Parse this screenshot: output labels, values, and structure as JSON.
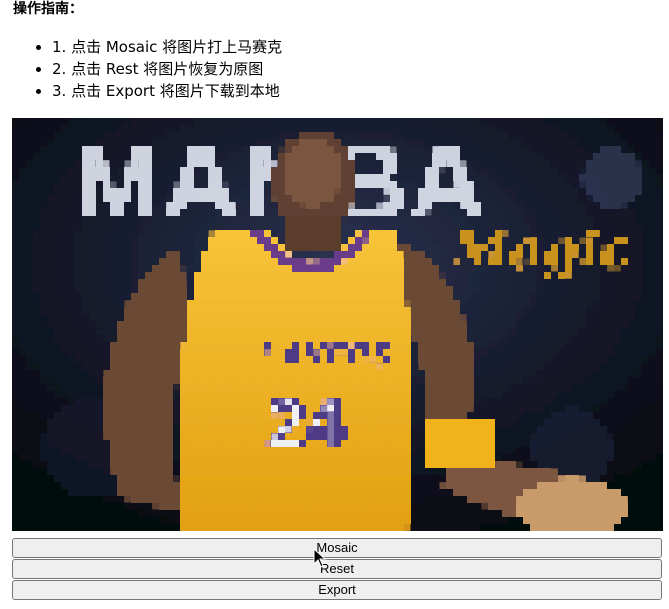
{
  "guide": {
    "title": "操作指南：",
    "steps": [
      "1. 点击 Mosaic 将图片打上马赛克",
      "2. 点击 Rest 将图片恢复为原图",
      "3. 点击 Export 将图片下载到本地"
    ]
  },
  "image": {
    "headline_text": "MAMBA",
    "script_text": "Magic",
    "jersey_brand": "LAKERS",
    "jersey_number": "24",
    "colors": {
      "background": "#0a0d1a",
      "jersey": "#f4b41a",
      "skin": "#6b4a36",
      "headline": "#dfe3ee",
      "script": "#c9921c"
    }
  },
  "buttons": {
    "mosaic": "Mosaic",
    "reset": "Reset",
    "export": "Export"
  }
}
